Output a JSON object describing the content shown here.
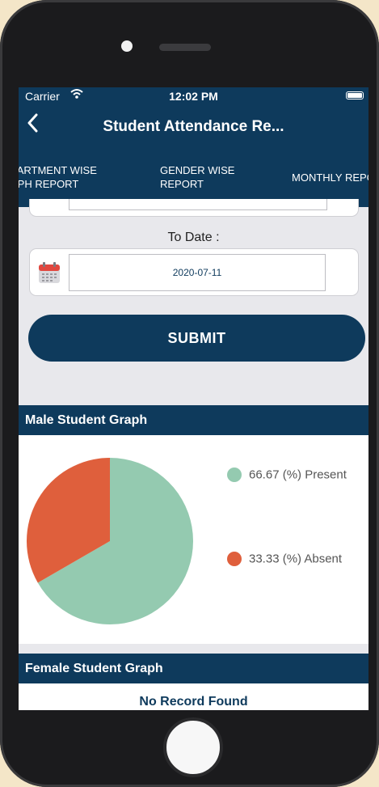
{
  "status_bar": {
    "carrier": "Carrier",
    "time": "12:02 PM"
  },
  "nav": {
    "title": "Student Attendance Re..."
  },
  "tabs": [
    {
      "line1": "PARTMENT WISE",
      "line2": "APH REPORT"
    },
    {
      "line1": "GENDER WISE",
      "line2": "REPORT"
    },
    {
      "line1": "MONTHLY REPO",
      "line2": ""
    }
  ],
  "form": {
    "to_date_label": "To Date :",
    "to_date_value": "2020-07-11",
    "submit_label": "SUBMIT"
  },
  "male": {
    "header": "Male Student Graph",
    "legend": [
      {
        "label": "66.67 (%) Present",
        "color": "#94cab0"
      },
      {
        "label": "33.33 (%) Absent",
        "color": "#df5f3c"
      }
    ]
  },
  "female": {
    "header": "Female Student Graph",
    "empty_text": "No Record Found"
  },
  "chart_data": {
    "type": "pie",
    "categories": [
      "Present",
      "Absent"
    ],
    "values": [
      66.67,
      33.33
    ],
    "colors": [
      "#94cab0",
      "#df5f3c"
    ]
  },
  "icons": {
    "back": "chevron-left-icon",
    "wifi": "wifi-icon",
    "battery": "battery-icon",
    "calendar": "calendar-icon"
  }
}
